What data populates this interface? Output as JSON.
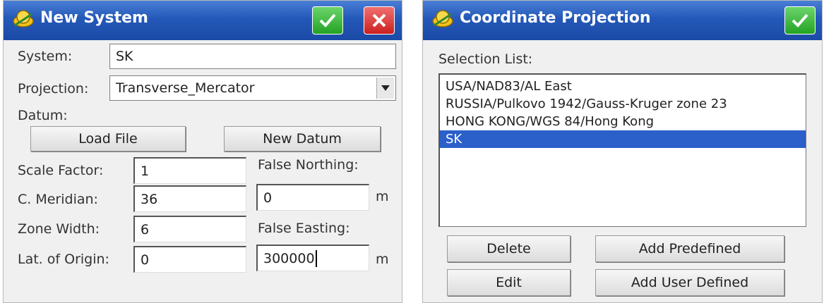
{
  "new_system": {
    "title": "New System",
    "system_label": "System:",
    "system_value": "SK",
    "projection_label": "Projection:",
    "projection_value": "Transverse_Mercator",
    "datum_label": "Datum:",
    "load_file_label": "Load File",
    "new_datum_label": "New Datum",
    "scale_factor_label": "Scale Factor:",
    "scale_factor_value": "1",
    "false_northing_label": "False Northing:",
    "false_northing_value": "0",
    "c_meridian_label": "C. Meridian:",
    "c_meridian_value": "36",
    "zone_width_label": "Zone Width:",
    "zone_width_value": "6",
    "false_easting_label": "False Easting:",
    "false_easting_value": "300000",
    "lat_origin_label": "Lat. of Origin:",
    "lat_origin_value": "0",
    "unit_m": "m"
  },
  "coordinate_projection": {
    "title": "Coordinate Projection",
    "selection_label": "Selection List:",
    "items": [
      "USA/NAD83/AL East",
      "RUSSIA/Pulkovo 1942/Gauss-Kruger zone 23",
      "HONG KONG/WGS 84/Hong Kong",
      "SK"
    ],
    "selected_index": 3,
    "delete_label": "Delete",
    "add_predefined_label": "Add Predefined",
    "edit_label": "Edit",
    "add_user_defined_label": "Add User Defined"
  },
  "colors": {
    "titlebar": "#2458b8",
    "ok": "#23a323",
    "cancel": "#cc1f1f",
    "selection": "#2b5fc9"
  },
  "icons": {
    "logo": "satellite-logo-icon",
    "ok": "checkmark-icon",
    "cancel": "close-icon",
    "dropdown": "chevron-down-icon"
  }
}
